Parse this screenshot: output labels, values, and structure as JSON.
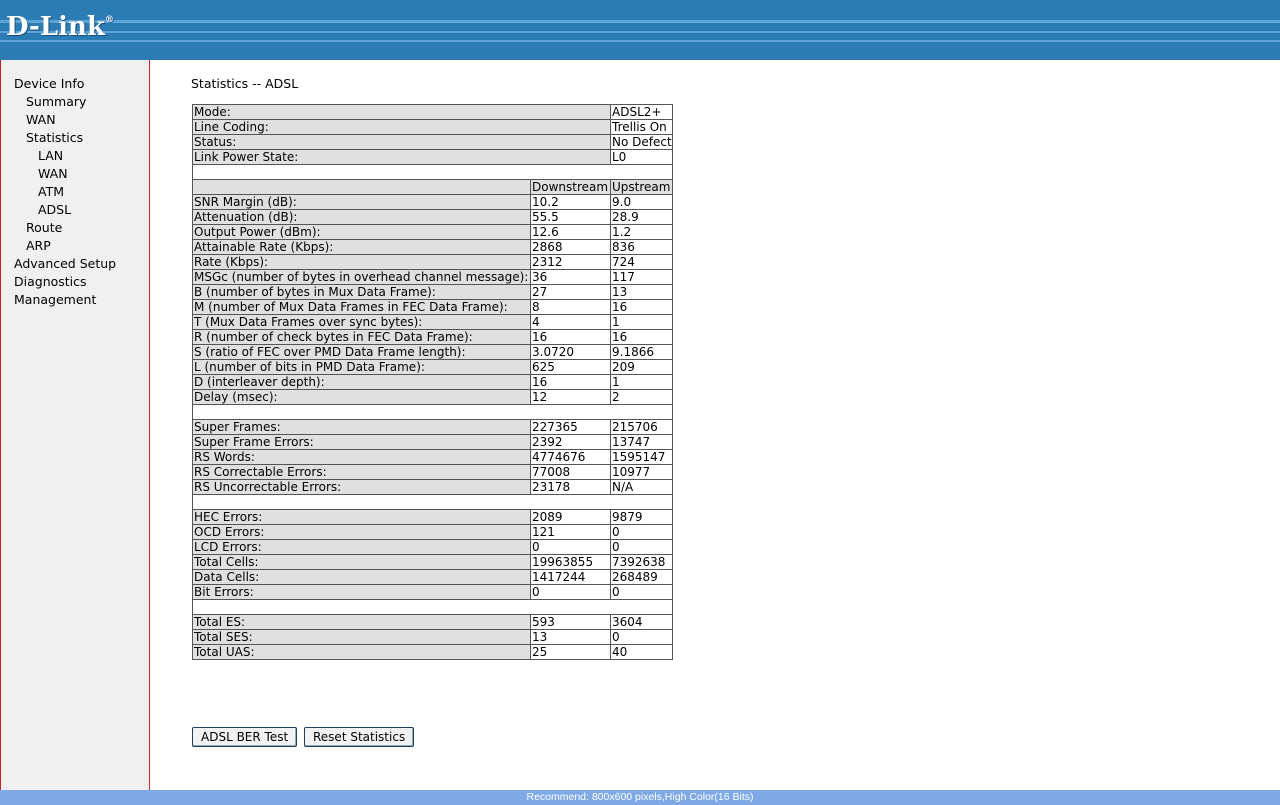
{
  "header": {
    "logo_text": "D-Link",
    "logo_mark": "®"
  },
  "sidebar": {
    "items": [
      {
        "label": "Device Info"
      },
      {
        "label": "Summary"
      },
      {
        "label": "WAN"
      },
      {
        "label": "Statistics"
      },
      {
        "label": "LAN"
      },
      {
        "label": "WAN"
      },
      {
        "label": "ATM"
      },
      {
        "label": "ADSL"
      },
      {
        "label": "Route"
      },
      {
        "label": "ARP"
      },
      {
        "label": "Advanced Setup"
      },
      {
        "label": "Diagnostics"
      },
      {
        "label": "Management"
      }
    ]
  },
  "page": {
    "title": "Statistics -- ADSL"
  },
  "summary": [
    {
      "label": "Mode:",
      "value": "ADSL2+"
    },
    {
      "label": "Line Coding:",
      "value": "Trellis On"
    },
    {
      "label": "Status:",
      "value": "No Defect"
    },
    {
      "label": "Link Power State:",
      "value": "L0"
    }
  ],
  "columns": {
    "downstream": "Downstream",
    "upstream": "Upstream"
  },
  "groups": [
    [
      {
        "label": "SNR Margin (dB):",
        "down": "10.2",
        "up": "9.0"
      },
      {
        "label": "Attenuation (dB):",
        "down": "55.5",
        "up": "28.9"
      },
      {
        "label": "Output Power (dBm):",
        "down": "12.6",
        "up": "1.2"
      },
      {
        "label": "Attainable Rate (Kbps):",
        "down": "2868",
        "up": "836"
      },
      {
        "label": "Rate (Kbps):",
        "down": "2312",
        "up": "724"
      },
      {
        "label": "MSGc (number of bytes in overhead channel message):",
        "down": "36",
        "up": "117"
      },
      {
        "label": "B (number of bytes in Mux Data Frame):",
        "down": "27",
        "up": "13"
      },
      {
        "label": "M (number of Mux Data Frames in FEC Data Frame):",
        "down": "8",
        "up": "16"
      },
      {
        "label": "T (Mux Data Frames over sync bytes):",
        "down": "4",
        "up": "1"
      },
      {
        "label": "R (number of check bytes in FEC Data Frame):",
        "down": "16",
        "up": "16"
      },
      {
        "label": "S (ratio of FEC over PMD Data Frame length):",
        "down": "3.0720",
        "up": "9.1866"
      },
      {
        "label": "L (number of bits in PMD Data Frame):",
        "down": "625",
        "up": "209"
      },
      {
        "label": "D (interleaver depth):",
        "down": "16",
        "up": "1"
      },
      {
        "label": "Delay (msec):",
        "down": "12",
        "up": "2"
      }
    ],
    [
      {
        "label": "Super Frames:",
        "down": "227365",
        "up": "215706"
      },
      {
        "label": "Super Frame Errors:",
        "down": "2392",
        "up": "13747"
      },
      {
        "label": "RS Words:",
        "down": "4774676",
        "up": "1595147"
      },
      {
        "label": "RS Correctable Errors:",
        "down": "77008",
        "up": "10977"
      },
      {
        "label": "RS Uncorrectable Errors:",
        "down": "23178",
        "up": "N/A"
      }
    ],
    [
      {
        "label": "HEC Errors:",
        "down": "2089",
        "up": "9879"
      },
      {
        "label": "OCD Errors:",
        "down": "121",
        "up": "0"
      },
      {
        "label": "LCD Errors:",
        "down": "0",
        "up": "0"
      },
      {
        "label": "Total Cells:",
        "down": "19963855",
        "up": "7392638"
      },
      {
        "label": "Data Cells:",
        "down": "1417244",
        "up": "268489"
      },
      {
        "label": "Bit Errors:",
        "down": "0",
        "up": "0"
      }
    ],
    [
      {
        "label": "Total ES:",
        "down": "593",
        "up": "3604"
      },
      {
        "label": "Total SES:",
        "down": "13",
        "up": "0"
      },
      {
        "label": "Total UAS:",
        "down": "25",
        "up": "40"
      }
    ]
  ],
  "buttons": {
    "ber_test": "ADSL BER Test",
    "reset": "Reset Statistics"
  },
  "footer": {
    "text": "Recommend: 800x600 pixels,High Color(16 Bits)"
  },
  "colors": {
    "header_bg": "#2b7cb5",
    "sidebar_bg": "#f0f0f0",
    "sidebar_border": "#c0262b",
    "label_cell_bg": "#e0e0e0",
    "footer_bg": "#7ea9e6"
  }
}
